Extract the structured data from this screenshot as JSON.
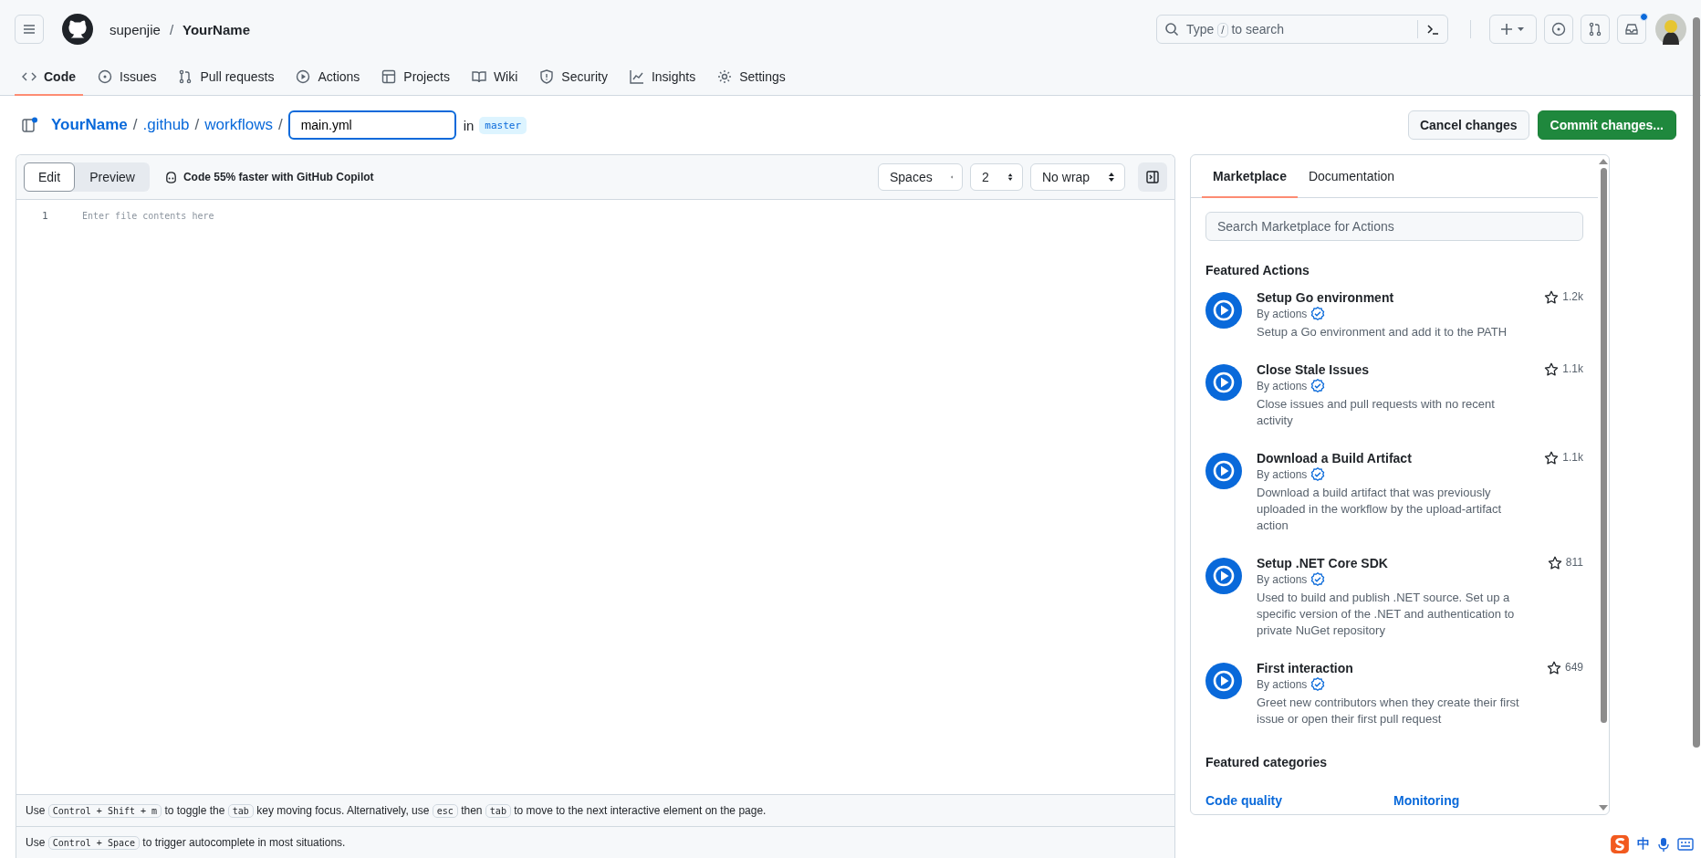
{
  "header": {
    "owner": "supenjie",
    "separator": "/",
    "repo": "YourName",
    "search": {
      "segments": [
        {
          "kind": "text",
          "text": "Type "
        },
        {
          "kind": "kbd",
          "text": "/"
        },
        {
          "kind": "text",
          "text": " to search"
        }
      ]
    },
    "notifications_unread": true
  },
  "nav_tabs": [
    {
      "label": "Code",
      "selected": true
    },
    {
      "label": "Issues",
      "selected": false
    },
    {
      "label": "Pull requests",
      "selected": false
    },
    {
      "label": "Actions",
      "selected": false
    },
    {
      "label": "Projects",
      "selected": false
    },
    {
      "label": "Wiki",
      "selected": false
    },
    {
      "label": "Security",
      "selected": false
    },
    {
      "label": "Insights",
      "selected": false
    },
    {
      "label": "Settings",
      "selected": false
    }
  ],
  "breadcrumb": {
    "crumbs": [
      {
        "label": "YourName",
        "bold": true,
        "sep": "/"
      },
      {
        "label": ".github",
        "bold": false,
        "sep": "/"
      },
      {
        "label": "workflows",
        "bold": false,
        "sep": "/"
      }
    ],
    "filename": "main.yml",
    "in": "in",
    "branch": "master"
  },
  "actions": [
    {
      "label": "Cancel changes",
      "kind": "default"
    },
    {
      "label": "Commit changes...",
      "kind": "primary"
    }
  ],
  "editor": {
    "tabs": [
      {
        "label": "Edit",
        "selected": true
      },
      {
        "label": "Preview",
        "selected": false
      }
    ],
    "copilot": "Code 55% faster with GitHub Copilot",
    "selects": [
      "Spaces",
      "2",
      "No wrap"
    ],
    "line_numbers": [
      "1"
    ],
    "placeholder": "Enter file contents here",
    "hints": [
      [
        {
          "kind": "text",
          "text": "Use "
        },
        {
          "kind": "kbd",
          "text": "Control + Shift + m"
        },
        {
          "kind": "text",
          "text": " to toggle the "
        },
        {
          "kind": "kbd",
          "text": "tab"
        },
        {
          "kind": "text",
          "text": " key moving focus. Alternatively, use "
        },
        {
          "kind": "kbd",
          "text": "esc"
        },
        {
          "kind": "text",
          "text": " then "
        },
        {
          "kind": "kbd",
          "text": "tab"
        },
        {
          "kind": "text",
          "text": " to move to the next interactive element on the page."
        }
      ],
      [
        {
          "kind": "text",
          "text": "Use "
        },
        {
          "kind": "kbd",
          "text": "Control + Space"
        },
        {
          "kind": "text",
          "text": " to trigger autocomplete in most situations."
        }
      ]
    ]
  },
  "marketplace": {
    "tabs": [
      {
        "label": "Marketplace",
        "selected": true
      },
      {
        "label": "Documentation",
        "selected": false
      }
    ],
    "search": {
      "placeholder": "Search Marketplace for Actions"
    },
    "featured_heading": "Featured Actions",
    "items": [
      {
        "title": "Setup Go environment",
        "by": "By actions",
        "verified": true,
        "description": "Setup a Go environment and add it to the PATH",
        "stars": "1.2k"
      },
      {
        "title": "Close Stale Issues",
        "by": "By actions",
        "verified": true,
        "description": "Close issues and pull requests with no recent activity",
        "stars": "1.1k"
      },
      {
        "title": "Download a Build Artifact",
        "by": "By actions",
        "verified": true,
        "description": "Download a build artifact that was previously uploaded in the workflow by the upload-artifact action",
        "stars": "1.1k"
      },
      {
        "title": "Setup .NET Core SDK",
        "by": "By actions",
        "verified": true,
        "description": "Used to build and publish .NET source. Set up a specific version of the .NET and authentication to private NuGet repository",
        "stars": "811"
      },
      {
        "title": "First interaction",
        "by": "By actions",
        "verified": true,
        "description": "Greet new contributors when they create their first issue or open their first pull request",
        "stars": "649"
      }
    ],
    "categories_heading": "Featured categories",
    "categories": [
      "Code quality",
      "Monitoring"
    ]
  },
  "ime": {
    "mode": "中"
  }
}
